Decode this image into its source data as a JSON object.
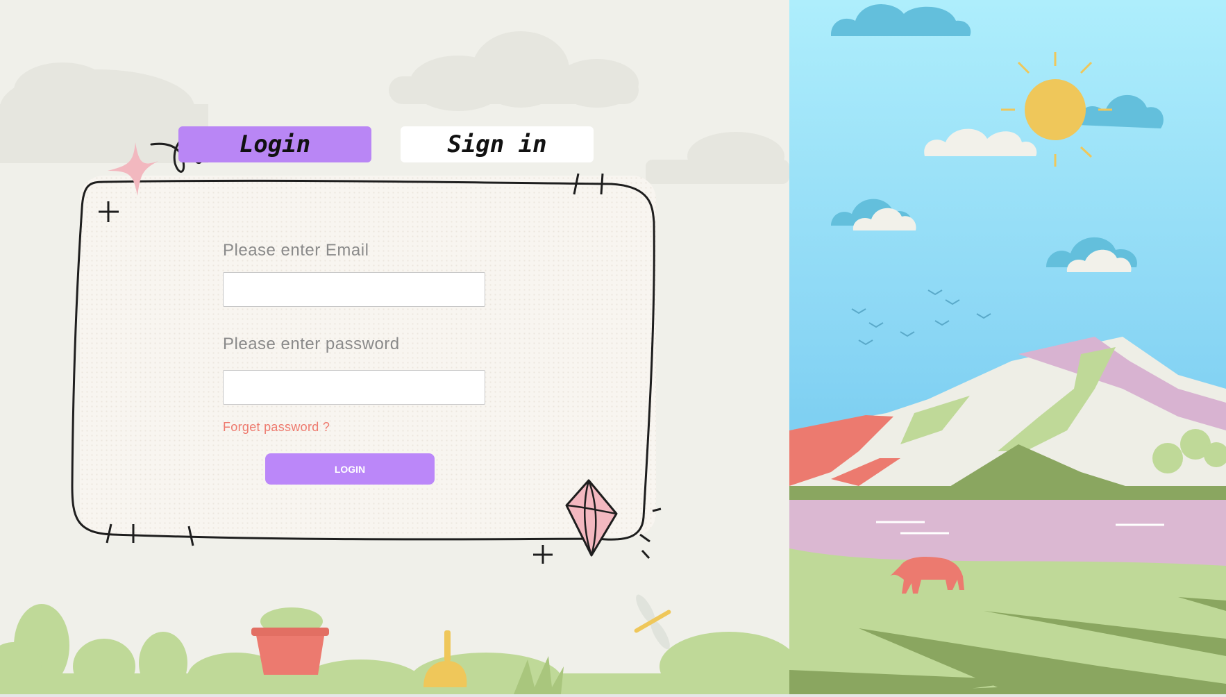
{
  "tabs": {
    "login_label": "Login",
    "signin_label": "Sign in",
    "active": "login"
  },
  "form": {
    "email_label": "Please enter Email",
    "email_value": "",
    "password_label": "Please enter password",
    "password_value": "",
    "forgot_label": "Forget password ?",
    "submit_label": "LOGIN"
  },
  "colors": {
    "accent": "#b986f5",
    "link": "#ee7a6e",
    "sky": "#aeeefc",
    "grass": "#bfd998"
  }
}
